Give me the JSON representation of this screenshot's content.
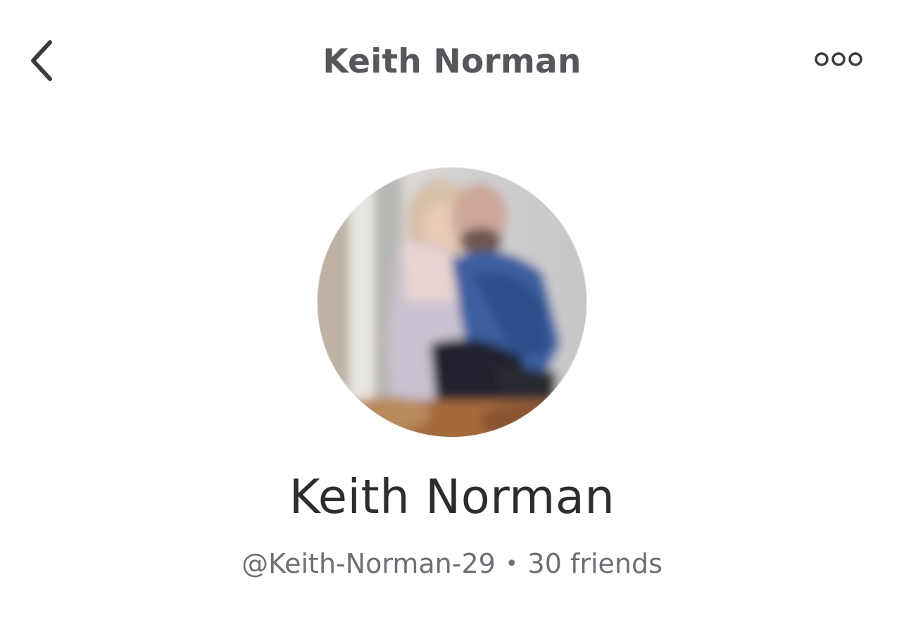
{
  "header": {
    "title": "Keith Norman",
    "back_icon": "chevron-left-icon",
    "more_icon": "ellipsis-icon"
  },
  "profile": {
    "avatar_icon": "profile-photo",
    "name": "Keith Norman",
    "username": "@Keith-Norman-29",
    "separator": "•",
    "friends": "30 friends"
  },
  "colors": {
    "title": "#55575c",
    "name": "#2c2d31",
    "meta": "#6d6f75",
    "icon": "#3a3b3f"
  }
}
